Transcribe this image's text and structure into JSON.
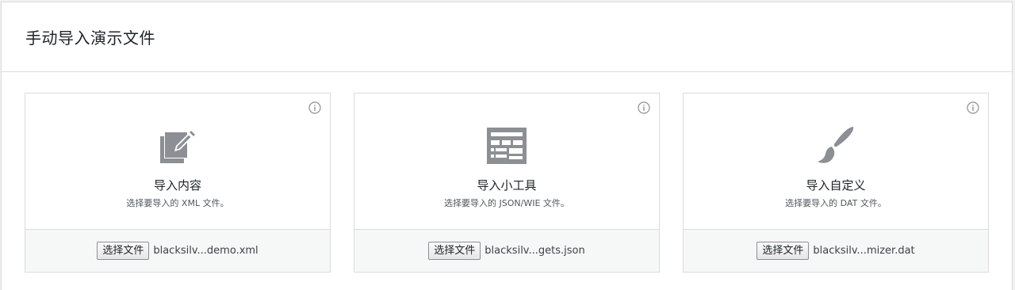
{
  "header": {
    "title": "手动导入演示文件"
  },
  "cards": [
    {
      "title": "导入内容",
      "description": "选择要导入的 XML 文件。",
      "icon": "edit-page-icon",
      "button_label": "选择文件",
      "file_name": "blacksilv...demo.xml"
    },
    {
      "title": "导入小工具",
      "description": "选择要导入的 JSON/WIE 文件。",
      "icon": "widgets-table-icon",
      "button_label": "选择文件",
      "file_name": "blacksilv...gets.json"
    },
    {
      "title": "导入自定义",
      "description": "选择要导入的 DAT 文件。",
      "icon": "paintbrush-icon",
      "button_label": "选择文件",
      "file_name": "blacksilv...mizer.dat"
    }
  ],
  "colors": {
    "icon_gray": "#8c8f94",
    "border": "#dcdcde",
    "footer_bg": "#f6f7f7"
  }
}
